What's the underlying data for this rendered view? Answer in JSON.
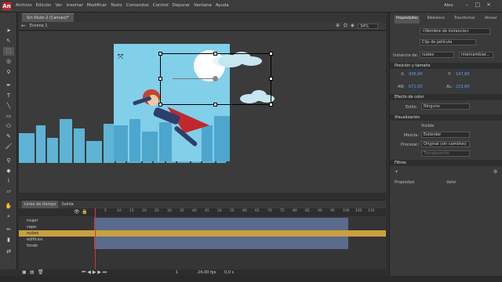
{
  "app": {
    "logo": "An",
    "menus": [
      "Archivo",
      "Edición",
      "Ver",
      "Insertar",
      "Modificar",
      "Texto",
      "Comandos",
      "Control",
      "Depurar",
      "Ventana",
      "Ayuda"
    ],
    "user": "Alex",
    "win_min": "–",
    "win_max": "□",
    "win_close": "×"
  },
  "document": {
    "tab": "Sin título-2 (Canvas)*",
    "scene": "Escena 1",
    "zoom": "34%"
  },
  "timeline": {
    "tabs": [
      "Línea de tiempo",
      "Salida"
    ],
    "frames": [
      "1",
      "5",
      "10",
      "15",
      "20",
      "25",
      "30",
      "35",
      "40",
      "45",
      "50",
      "55",
      "60",
      "65",
      "70",
      "75",
      "80",
      "85",
      "90",
      "95",
      "100",
      "105",
      "110"
    ],
    "layers": [
      "mujer",
      "capa",
      "nubes",
      "edificios",
      "fondo"
    ],
    "fps": "24,00 fps",
    "time": "0,0 s",
    "frame": "1"
  },
  "properties": {
    "tabs": [
      "Propiedades",
      "Biblioteca",
      "Transformar",
      "Alinear"
    ],
    "instance_placeholder": "<Nombre de instancia>",
    "symbol_type": "Clip de película",
    "instance_label": "Instancia de:",
    "instance_of": "nubes",
    "swap_button": "Intercambiar...",
    "section_position": "Posición y tamaño",
    "x_label": "X:",
    "x": "436,90",
    "y_label": "Y:",
    "y": "147,85",
    "w_label": "AN:",
    "w": "671,05",
    "h_label": "AL:",
    "h": "223,80",
    "section_color": "Efecto de color",
    "style_label": "Estilo:",
    "style": "Ninguno",
    "section_display": "Visualización",
    "visible": "Visible",
    "blend_label": "Mezcla:",
    "blend": "Estándar",
    "render_label": "Procesar:",
    "render": "Original (sin cambios)",
    "transparent": "Transparente",
    "section_filters": "Filtros",
    "col_prop": "Propiedad",
    "col_val": "Valor"
  },
  "colors": {
    "accent": "#c1272d",
    "sky": "#82cfea",
    "selected_layer": "#c8a040"
  }
}
